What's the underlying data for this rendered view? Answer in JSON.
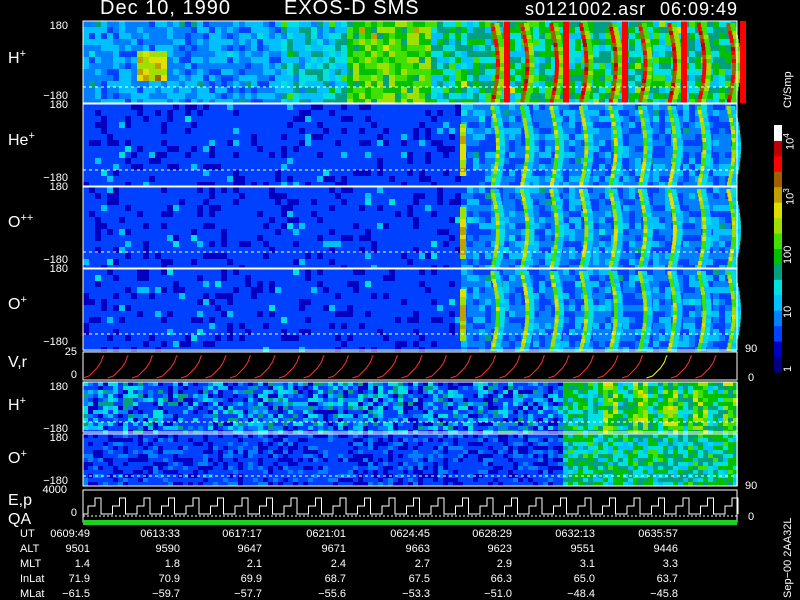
{
  "header": {
    "date": "Dec 10, 1990",
    "mission": "EXOS-D SMS",
    "file": "s0121002.asr",
    "time": "06:09:49"
  },
  "colorbar": {
    "unit": "Ct/Smp",
    "ticks": [
      "1",
      "10",
      "100",
      "10^3",
      "10^4"
    ],
    "colors": [
      "#000080",
      "#0000c0",
      "#0040ff",
      "#0080ff",
      "#00c0ff",
      "#00e0e0",
      "#00a080",
      "#00c000",
      "#40e000",
      "#a0e000",
      "#e0e000",
      "#c0a000",
      "#a06000",
      "#ff0000",
      "#c00000",
      "#ffffff"
    ]
  },
  "panels": [
    {
      "label": "H",
      "sup": "+",
      "ymax": "180",
      "ymin": "−180"
    },
    {
      "label": "He",
      "sup": "+",
      "ymax": "180",
      "ymin": "−180"
    },
    {
      "label": "O",
      "sup": "++",
      "ymax": "180",
      "ymin": "−180"
    },
    {
      "label": "O",
      "sup": "+",
      "ymax": "180",
      "ymin": "−180"
    }
  ],
  "vr": {
    "label": "V,r",
    "ymax": "25",
    "ymin": "0",
    "right_top": "90",
    "right_bot": "0"
  },
  "small_panels": [
    {
      "label": "H",
      "sup": "+",
      "ymax": "180",
      "ymin": "−180"
    },
    {
      "label": "O",
      "sup": "+",
      "ymax": "180",
      "ymin": "−180"
    }
  ],
  "ep": {
    "label": "E,p",
    "ymax": "4000",
    "ymin": "0",
    "right_top": "90",
    "right_bot": "0"
  },
  "qa": {
    "label": "QA"
  },
  "side_note": "Sep−00 2AA32L",
  "chart_data": {
    "type": "heatmap",
    "title": "Dec 10, 1990   EXOS-D SMS",
    "table": {
      "columns": [
        "0609:49",
        "0613:33",
        "0617:17",
        "0621:01",
        "0624:45",
        "0628:29",
        "0632:13",
        "0635:57"
      ],
      "rows": [
        {
          "name": "UT",
          "values": [
            "0609:49",
            "0613:33",
            "0617:17",
            "0621:01",
            "0624:45",
            "0628:29",
            "0632:13",
            "0635:57"
          ]
        },
        {
          "name": "ALT",
          "values": [
            "9501",
            "9590",
            "9647",
            "9671",
            "9663",
            "9623",
            "9551",
            "9446"
          ]
        },
        {
          "name": "MLT",
          "values": [
            "1.4",
            "1.8",
            "2.1",
            "2.4",
            "2.7",
            "2.9",
            "3.1",
            "3.3"
          ]
        },
        {
          "name": "InLat",
          "values": [
            "71.9",
            "70.9",
            "69.9",
            "68.7",
            "67.5",
            "66.3",
            "65.0",
            "63.7"
          ]
        },
        {
          "name": "MLat",
          "values": [
            "−61.5",
            "−59.7",
            "−57.7",
            "−55.6",
            "−53.3",
            "−51.0",
            "−48.4",
            "−45.8"
          ]
        }
      ]
    }
  }
}
